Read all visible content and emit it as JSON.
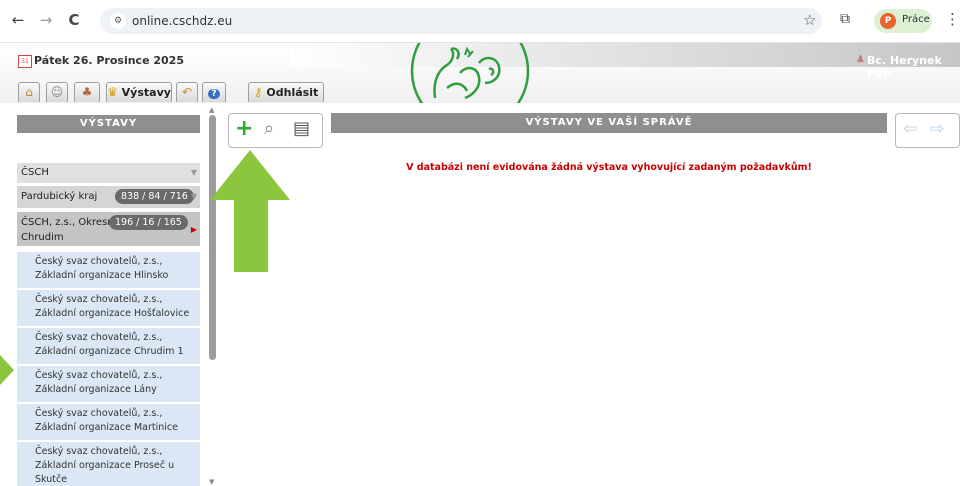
{
  "browser": {
    "url": "online.cschdz.eu",
    "profile_initial": "P",
    "profile_name": "Práce",
    "back": "←",
    "forward": "→",
    "reload": "C",
    "site_icon": "⚙",
    "star": "☆",
    "extension": "⧉",
    "menu": "⋮"
  },
  "header": {
    "date": "Pátek 26. Prosince 2025",
    "user": "Bc. Herynek Petr",
    "tabs": [
      {
        "icon": "home-icon",
        "glyph": "⌂",
        "label": ""
      },
      {
        "icon": "people-icon",
        "glyph": "☺",
        "label": ""
      },
      {
        "icon": "members-icon",
        "glyph": "♣",
        "label": ""
      },
      {
        "icon": "trophy-icon",
        "glyph": "♛",
        "label": "Výstavy"
      },
      {
        "icon": "undo-icon",
        "glyph": "↶",
        "label": ""
      },
      {
        "icon": "help-icon",
        "glyph": "?",
        "label": ""
      }
    ],
    "logout": {
      "icon": "key-icon",
      "glyph": "⚷",
      "label": "Odhlásit"
    }
  },
  "sidebar": {
    "title": "VÝSTAVY",
    "csch": "ČSCH",
    "kraj": {
      "label": "Pardubický kraj",
      "count": "838 / 84 / 716"
    },
    "okres": {
      "label_line1": "ČSCH, z.s., Okresn",
      "label_line2": "Chrudim",
      "count": "196 / 16 / 165"
    },
    "items": [
      {
        "line1": "Český svaz chovatelů, z.s.,",
        "line2": "Základní organizace Hlinsko"
      },
      {
        "line1": "Český svaz chovatelů, z.s.,",
        "line2": "Základní organizace Hošťalovice"
      },
      {
        "line1": "Český svaz chovatelů, z.s.,",
        "line2": "Základní organizace Chrudim 1"
      },
      {
        "line1": "Český svaz chovatelů, z.s.,",
        "line2": "Základní organizace Lány"
      },
      {
        "line1": "Český svaz chovatelů, z.s.,",
        "line2": "Základní organizace Martinice"
      },
      {
        "line1": "Český svaz chovatelů, z.s.,",
        "line2": "Základní organizace Proseč u",
        "line3": "Skutče"
      }
    ]
  },
  "toolbar": {
    "add": "+",
    "search": "⌕",
    "print": "▤"
  },
  "main": {
    "title": "VÝSTAVY VE VAŠÍ SPRÁVĚ",
    "message": "V databázi není evidována žádná výstava vyhovující zadaným požadavkům!",
    "prev": "⇦",
    "next": "⇨"
  },
  "colors": {
    "accent_green": "#8cc63f",
    "logo_green": "#2e9e3e",
    "message_red": "#c80000",
    "sidebar_blue": "#dbe7f5"
  }
}
